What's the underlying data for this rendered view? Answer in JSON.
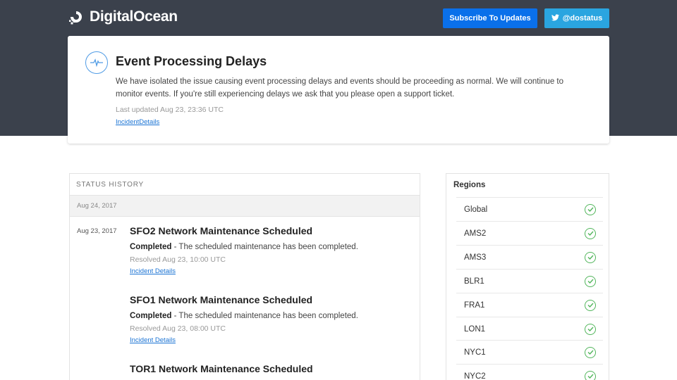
{
  "header": {
    "logo_text": "DigitalOcean",
    "subscribe_label": "Subscribe To Updates",
    "twitter_label": "@dostatus",
    "colors": {
      "band": "#3b414c",
      "subscribe": "#0a70ea",
      "twitter": "#2aa5e0"
    }
  },
  "incident": {
    "icon": "pulse-icon",
    "title": "Event Processing Delays",
    "body": "We have isolated the issue causing event processing delays and events should be proceeding as normal. We will continue to monitor events. If you're still experiencing delays we ask that you please open a support ticket.",
    "updated": "Last updated Aug 23, 23:36 UTC",
    "link": "IncidentDetails"
  },
  "history": {
    "header": "STATUS HISTORY",
    "date_bar": "Aug 24, 2017",
    "entry_date": "Aug 23, 2017",
    "entries": [
      {
        "title": "SFO2 Network Maintenance Scheduled",
        "status": "Completed",
        "desc": " - The scheduled maintenance has been completed.",
        "resolved": "Resolved Aug 23, 10:00 UTC",
        "link": "Incident Details"
      },
      {
        "title": "SFO1 Network Maintenance Scheduled",
        "status": "Completed",
        "desc": " - The scheduled maintenance has been completed.",
        "resolved": "Resolved Aug 23, 08:00 UTC",
        "link": "Incident Details"
      },
      {
        "title": "TOR1 Network Maintenance Scheduled"
      }
    ]
  },
  "regions": {
    "title": "Regions",
    "status_color": "#51b55b",
    "items": [
      "Global",
      "AMS2",
      "AMS3",
      "BLR1",
      "FRA1",
      "LON1",
      "NYC1",
      "NYC2"
    ]
  }
}
